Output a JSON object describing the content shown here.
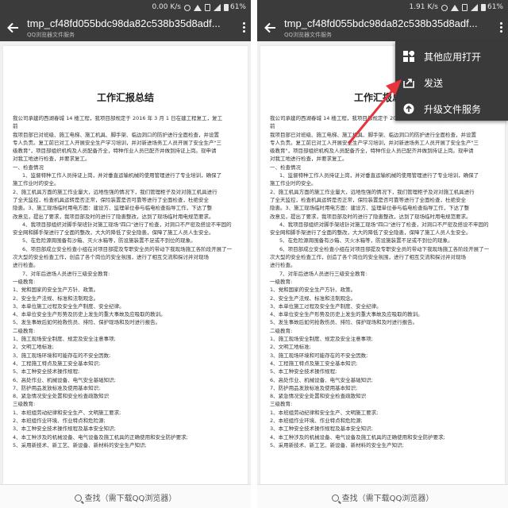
{
  "screens": [
    {
      "status": {
        "speed": "0.00 K/s",
        "battery": "61%"
      },
      "header": {
        "title": "tmp_cf48fd055bdc98da82c538b35d8adf...",
        "subtitle": "QQ浏览器文件服务"
      },
      "bottom": {
        "search": "查找（需下载QQ浏览器）"
      }
    },
    {
      "status": {
        "speed": "1.91 K/s",
        "battery": "61%"
      },
      "header": {
        "title": "tmp_cf48fd055bdc98da82c538b35d8adf...",
        "subtitle": "QQ浏览器文件服务"
      },
      "bottom": {
        "search": "查找（需下载QQ浏览器）"
      }
    }
  ],
  "document": {
    "title": "工作汇报总结",
    "lines": [
      "我公司承建的西湖春城 14 楼工程，我项目部规定于 2016 年 3 月 1 日在建工程复工，复工",
      "前",
      "我项目部已对班级、施工电梯、施工机具、脚手架、临边洞口的防护进行全面检查，并设置",
      "专人负责。复工前已对工人开展安全生产学习培训，并对新进场务工人员开展了安全生产\"三",
      "级教育\"，项目部组织机构及人员配备齐全，特种作业人员已配齐并做到持证上岗。现申请",
      "对我工地进行检查，并要求复工。",
      "一、检查情况",
      "1、监督特种工作人员持证上岗，并对垂直运输机械的使用管理进行了专业培训，确保了",
      "施工作业时的安全。",
      "2、施工机具方面的施工作业量大，远地性强的情况下，我们管理柜子及对对施工机具进行",
      "了全天监控，检查机具运转是否正常，保险装置是否可靠等进行了全面检查，杜绝安全",
      "隐患。3、施工现场临时用电方面：建设方、监理单位参与临电检查指导工作，下达了整",
      "改意见，提出了要求，我项目部及时的进行了隐患整改，达到了现场临时用电规范要求。",
      "4、我项目部组织对脚手架班针对施工现场\"四口\"进行了检查，对洞口不严密及搭设不牢固的",
      "安全网和脚手架进行了全面的整改，大大的降低了安全隐患，保障了施工人员人生安全。",
      "5、在危险源周围备有沙箱、灭火水箱等，防设施装置不足或不到位的现象。",
      "6、项目部成立安全检查小组在对项目部提及专职安全员的带动下我现场施工各阶段开展了一",
      "次大型的安全检查工作，创造了各个岗位的安全氛围，进行了相互交流和探讨并对现场",
      "进行检查。",
      "7、对年后进场人员进行三级安全教育:",
      "一级教育:",
      "1、党和国家的安全生产方针、政策。",
      "2、安全生产法规、标准和法制观念。",
      "3、本单位施工过程及安全生产制度、安全纪律。",
      "4、本单位安全生产形势及历史上发生的重大事故及应吸取的教训。",
      "5、发生事故后如何抢救伤员、排险、保护现场和及时进行报告。",
      "二级教育:",
      "1、施工现场安全制度、规定及安全注意事项;",
      "2、文明工地标准;",
      "3、施工现场环境和可能存在的不安全因数;",
      "4、工程施工特点及施工安全基本知识;",
      "5、本工种安全技术操作规程;",
      "6、高处作业、机械设备、电气安全基础知识;",
      "7、防护用品发放标准及使用基本知识;",
      "8、紧急情况安全处置和安全检查疏散知识",
      "三级教育:",
      "1、本班组劳动纪律和安全生产、文明施工要求;",
      "2、本班组作业环境、作业特点和危险源;",
      "3、本工种安全技术操作规程及基本安全知识;",
      "4、本工种涉及的机械设备、电气设备及施工机具的正确使用和安全防护要求;",
      "5、采用新技术、新工艺、新设备、新材料的安全生产知识;"
    ]
  },
  "menu": {
    "items": [
      {
        "label": "其他应用打开",
        "icon": "grid-icon"
      },
      {
        "label": "发送",
        "icon": "share-icon"
      },
      {
        "label": "升级文件服务",
        "icon": "upgrade-icon"
      }
    ]
  },
  "annotation": {
    "arrow_color": "#e8323c"
  },
  "colors": {
    "bar": "#3b3b3b",
    "menu": "#3a3a3a"
  }
}
